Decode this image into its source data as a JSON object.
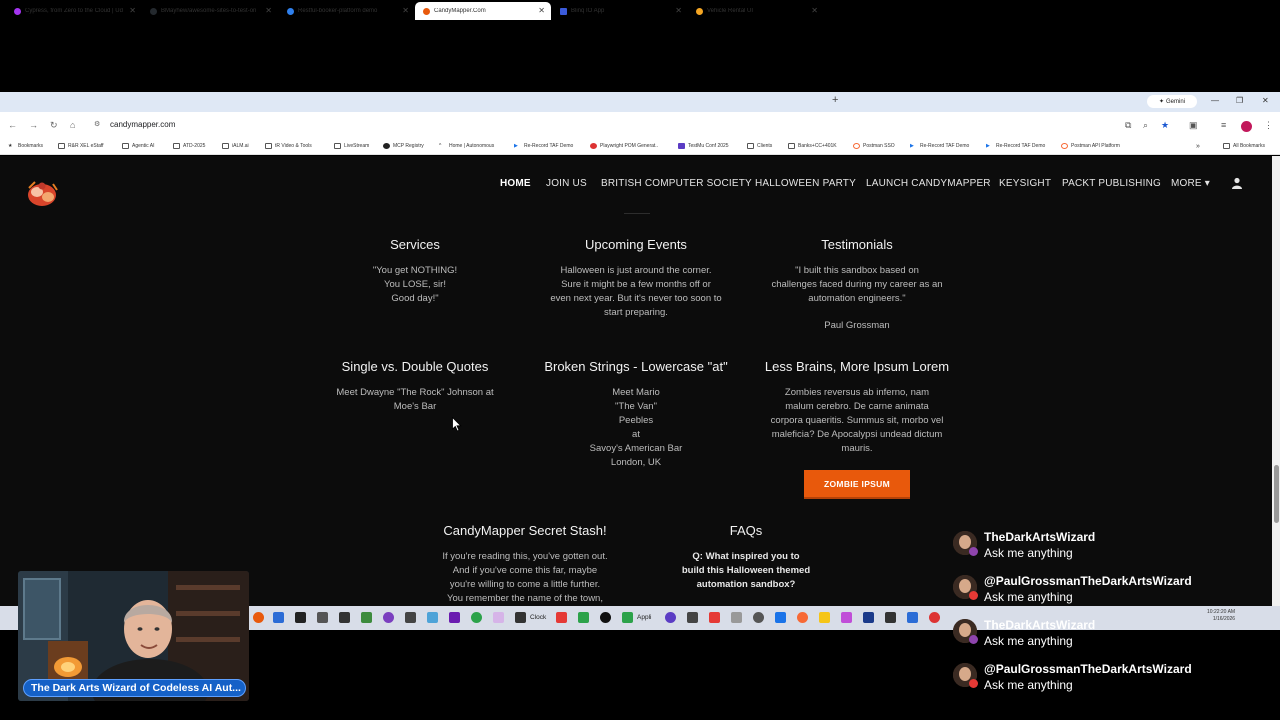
{
  "browser": {
    "tabs": [
      {
        "title": "Cypress, from Zero to the Cloud | Ud",
        "color": "#a435f0"
      },
      {
        "title": "BMayhew/awesome-sites-to-test-on",
        "color": "#24292e"
      },
      {
        "title": "Restful-booker-platform demo",
        "color": "#2f80ed"
      },
      {
        "title": "CandyMapper.Com",
        "color": "#e8590c"
      },
      {
        "title": "Blinq IO App",
        "color": "#3b5bdb"
      },
      {
        "title": "Vehicle Rental UI",
        "color": "#f5a623"
      }
    ],
    "gemini_label": "Gemini",
    "url": "candymapper.com",
    "bookmarks": [
      "Bookmarks",
      "R&R XEL eStaff",
      "Agentic AI",
      "ATD-2025",
      "iALM.ai",
      "tR Video & Tools",
      "LiveStream",
      "MCP Registry",
      "Home | Autonomous",
      "Re-Record TAF Demo",
      "Playwright POM Generat..",
      "TestMu Conf 2025",
      "Clients",
      "Banks+CC+401K",
      "Postman SSO",
      "Re-Record TAF Demo",
      "Re-Record TAF Demo",
      "Postman API Platform"
    ],
    "all_bookmarks": "All Bookmarks"
  },
  "site": {
    "nav": [
      "HOME",
      "JOIN US",
      "BRITISH COMPUTER SOCIETY",
      "HALLOWEEN PARTY",
      "LAUNCH CANDYMAPPER",
      "KEYSIGHT",
      "PACKT PUBLISHING",
      "MORE"
    ],
    "more_caret": "▾",
    "sections": {
      "services": {
        "title": "Services",
        "lines": [
          "\"You get NOTHING!",
          "You LOSE, sir!",
          "Good day!\""
        ]
      },
      "events": {
        "title": "Upcoming Events",
        "lines": [
          "Halloween is just around the corner.",
          "Sure it might be a few months off or",
          "even next year. But it's never too soon to",
          "start preparing."
        ]
      },
      "testimonials": {
        "title": "Testimonials",
        "lines": [
          "\"I built this sandbox based on",
          "challenges faced during my career as an",
          "automation engineers.\""
        ],
        "author": "Paul Grossman"
      },
      "quotes": {
        "title": "Single vs. Double Quotes",
        "lines": [
          "Meet Dwayne \"The Rock\" Johnson at",
          "Moe's Bar"
        ]
      },
      "strings": {
        "title": "Broken Strings - Lowercase \"at\"",
        "lines": [
          "Meet Mario",
          "\"The Van\"",
          "Peebles",
          "at",
          "Savoy's American Bar",
          "London, UK"
        ]
      },
      "brains": {
        "title": "Less Brains, More Ipsum Lorem",
        "lines": [
          "Zombies reversus ab inferno, nam",
          "malum cerebro. De carne animata",
          "corpora quaeritis. Summus sit, morbo vel",
          "maleficia? De Apocalypsi undead dictum",
          "mauris."
        ],
        "button": "ZOMBIE IPSUM"
      },
      "stash": {
        "title": "CandyMapper Secret Stash!",
        "lines": [
          "If you're reading this, you've gotten out.",
          "And if you've come this far, maybe",
          "you're willing to come a little further.",
          "You remember the name of the town,"
        ]
      },
      "faqs": {
        "title": "FAQs",
        "lines": [
          "Q: What inspired you to",
          "build this Halloween themed",
          "automation sandbox?"
        ]
      }
    }
  },
  "taskbar": {
    "clock_label": "Clock",
    "apps_label": "Appli",
    "time": "10:22:20 AM",
    "date": "1/16/2026"
  },
  "overlay": {
    "caption": "The Dark Arts Wizard of Codeless AI Aut...",
    "chat": [
      {
        "name": "TheDarkArtsWizard",
        "message": "Ask me anything",
        "badge": "#8e44ad"
      },
      {
        "name": "@PaulGrossmanTheDarkArtsWizard",
        "message": "Ask me anything",
        "badge": "#e53935"
      },
      {
        "name": "TheDarkArtsWizard",
        "message": "Ask me anything",
        "badge": "#8e44ad"
      },
      {
        "name": "@PaulGrossmanTheDarkArtsWizard",
        "message": "Ask me anything",
        "badge": "#e53935"
      }
    ]
  }
}
